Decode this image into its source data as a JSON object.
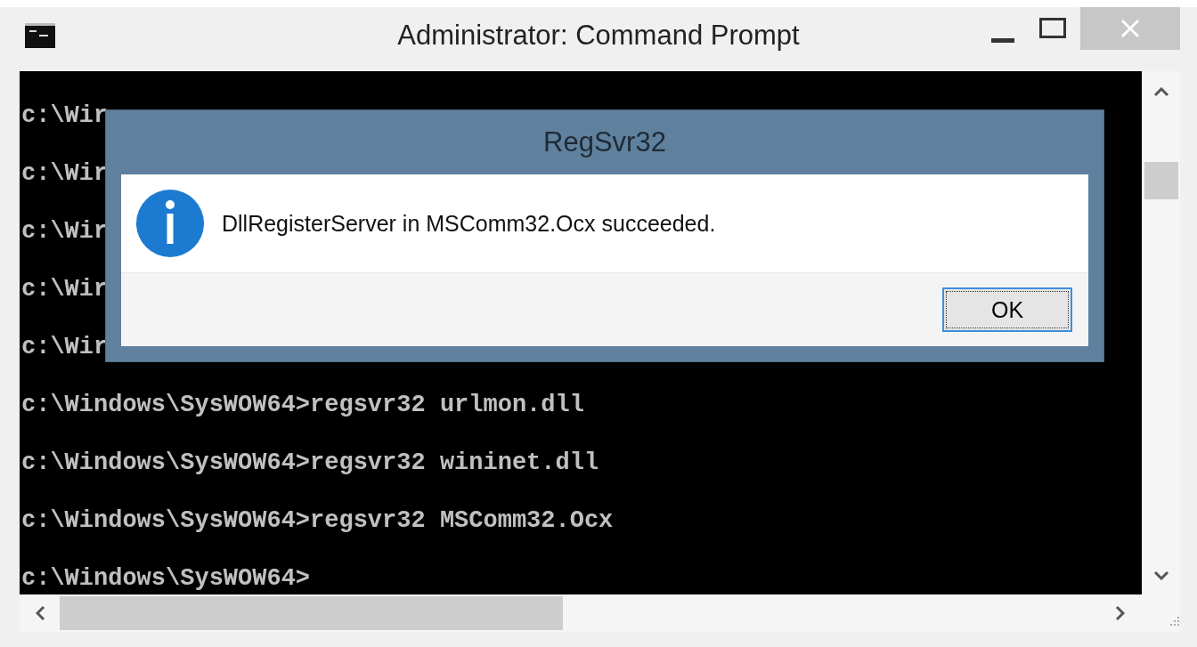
{
  "window": {
    "title": "Administrator: Command Prompt"
  },
  "console": {
    "lines": [
      "c:\\Wir",
      "c:\\Wir",
      "c:\\Wir",
      "c:\\Wir",
      "c:\\Wir",
      "c:\\Windows\\SysWOW64>regsvr32 urlmon.dll",
      "c:\\Windows\\SysWOW64>regsvr32 wininet.dll",
      "c:\\Windows\\SysWOW64>regsvr32 MSComm32.Ocx",
      "c:\\Windows\\SysWOW64>"
    ]
  },
  "dialog": {
    "title": "RegSvr32",
    "message": "DllRegisterServer in MSComm32.Ocx succeeded.",
    "buttons": [
      "OK"
    ]
  }
}
